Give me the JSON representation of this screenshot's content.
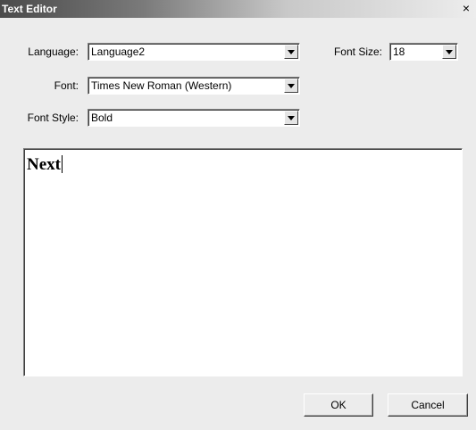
{
  "window": {
    "title": "Text Editor",
    "close_label": "×"
  },
  "form": {
    "language_label": "Language:",
    "language_value": "Language2",
    "font_size_label": "Font Size:",
    "font_size_value": "18",
    "font_label": "Font:",
    "font_value": "Times New Roman (Western)",
    "font_style_label": "Font Style:",
    "font_style_value": "Bold"
  },
  "editor": {
    "content": "Next"
  },
  "buttons": {
    "ok": "OK",
    "cancel": "Cancel"
  },
  "icons": {
    "dropdown": "chevron-down-icon",
    "close": "close-icon"
  },
  "colors": {
    "titlebar_start": "#4a4a4a",
    "titlebar_end": "#ededed",
    "dialog_bg": "#ececec"
  }
}
